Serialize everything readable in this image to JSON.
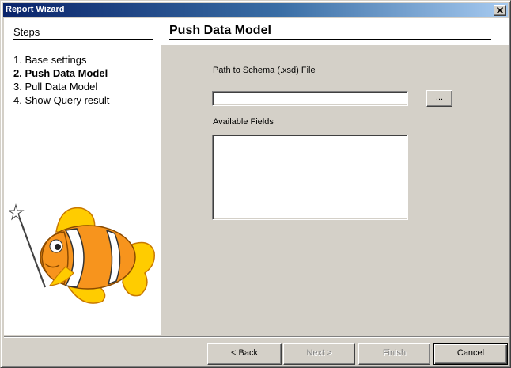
{
  "window": {
    "title": "Report Wizard",
    "close_glyph": "×"
  },
  "steps": {
    "header": "Steps",
    "items": [
      {
        "label": "1. Base settings",
        "active": false
      },
      {
        "label": "2. Push Data Model",
        "active": true
      },
      {
        "label": "3. Pull Data Model",
        "active": false
      },
      {
        "label": "4. Show Query result",
        "active": false
      }
    ]
  },
  "page": {
    "title": "Push Data Model",
    "schema_label": "Path to Schema (.xsd) File",
    "schema_value": "",
    "browse_label": "...",
    "fields_label": "Available Fields",
    "fields_items": []
  },
  "footer": {
    "back": "< Back",
    "next": "Next >",
    "finish": "Finish",
    "cancel": "Cancel"
  },
  "colors": {
    "dialog_face": "#d4d0c8",
    "title_gradient_start": "#0a246a",
    "title_gradient_end": "#a6caf0",
    "fish_orange": "#f7941d",
    "fish_yellow": "#ffcc00"
  },
  "illustration": {
    "icon": "clownfish-with-magic-wand-icon"
  }
}
